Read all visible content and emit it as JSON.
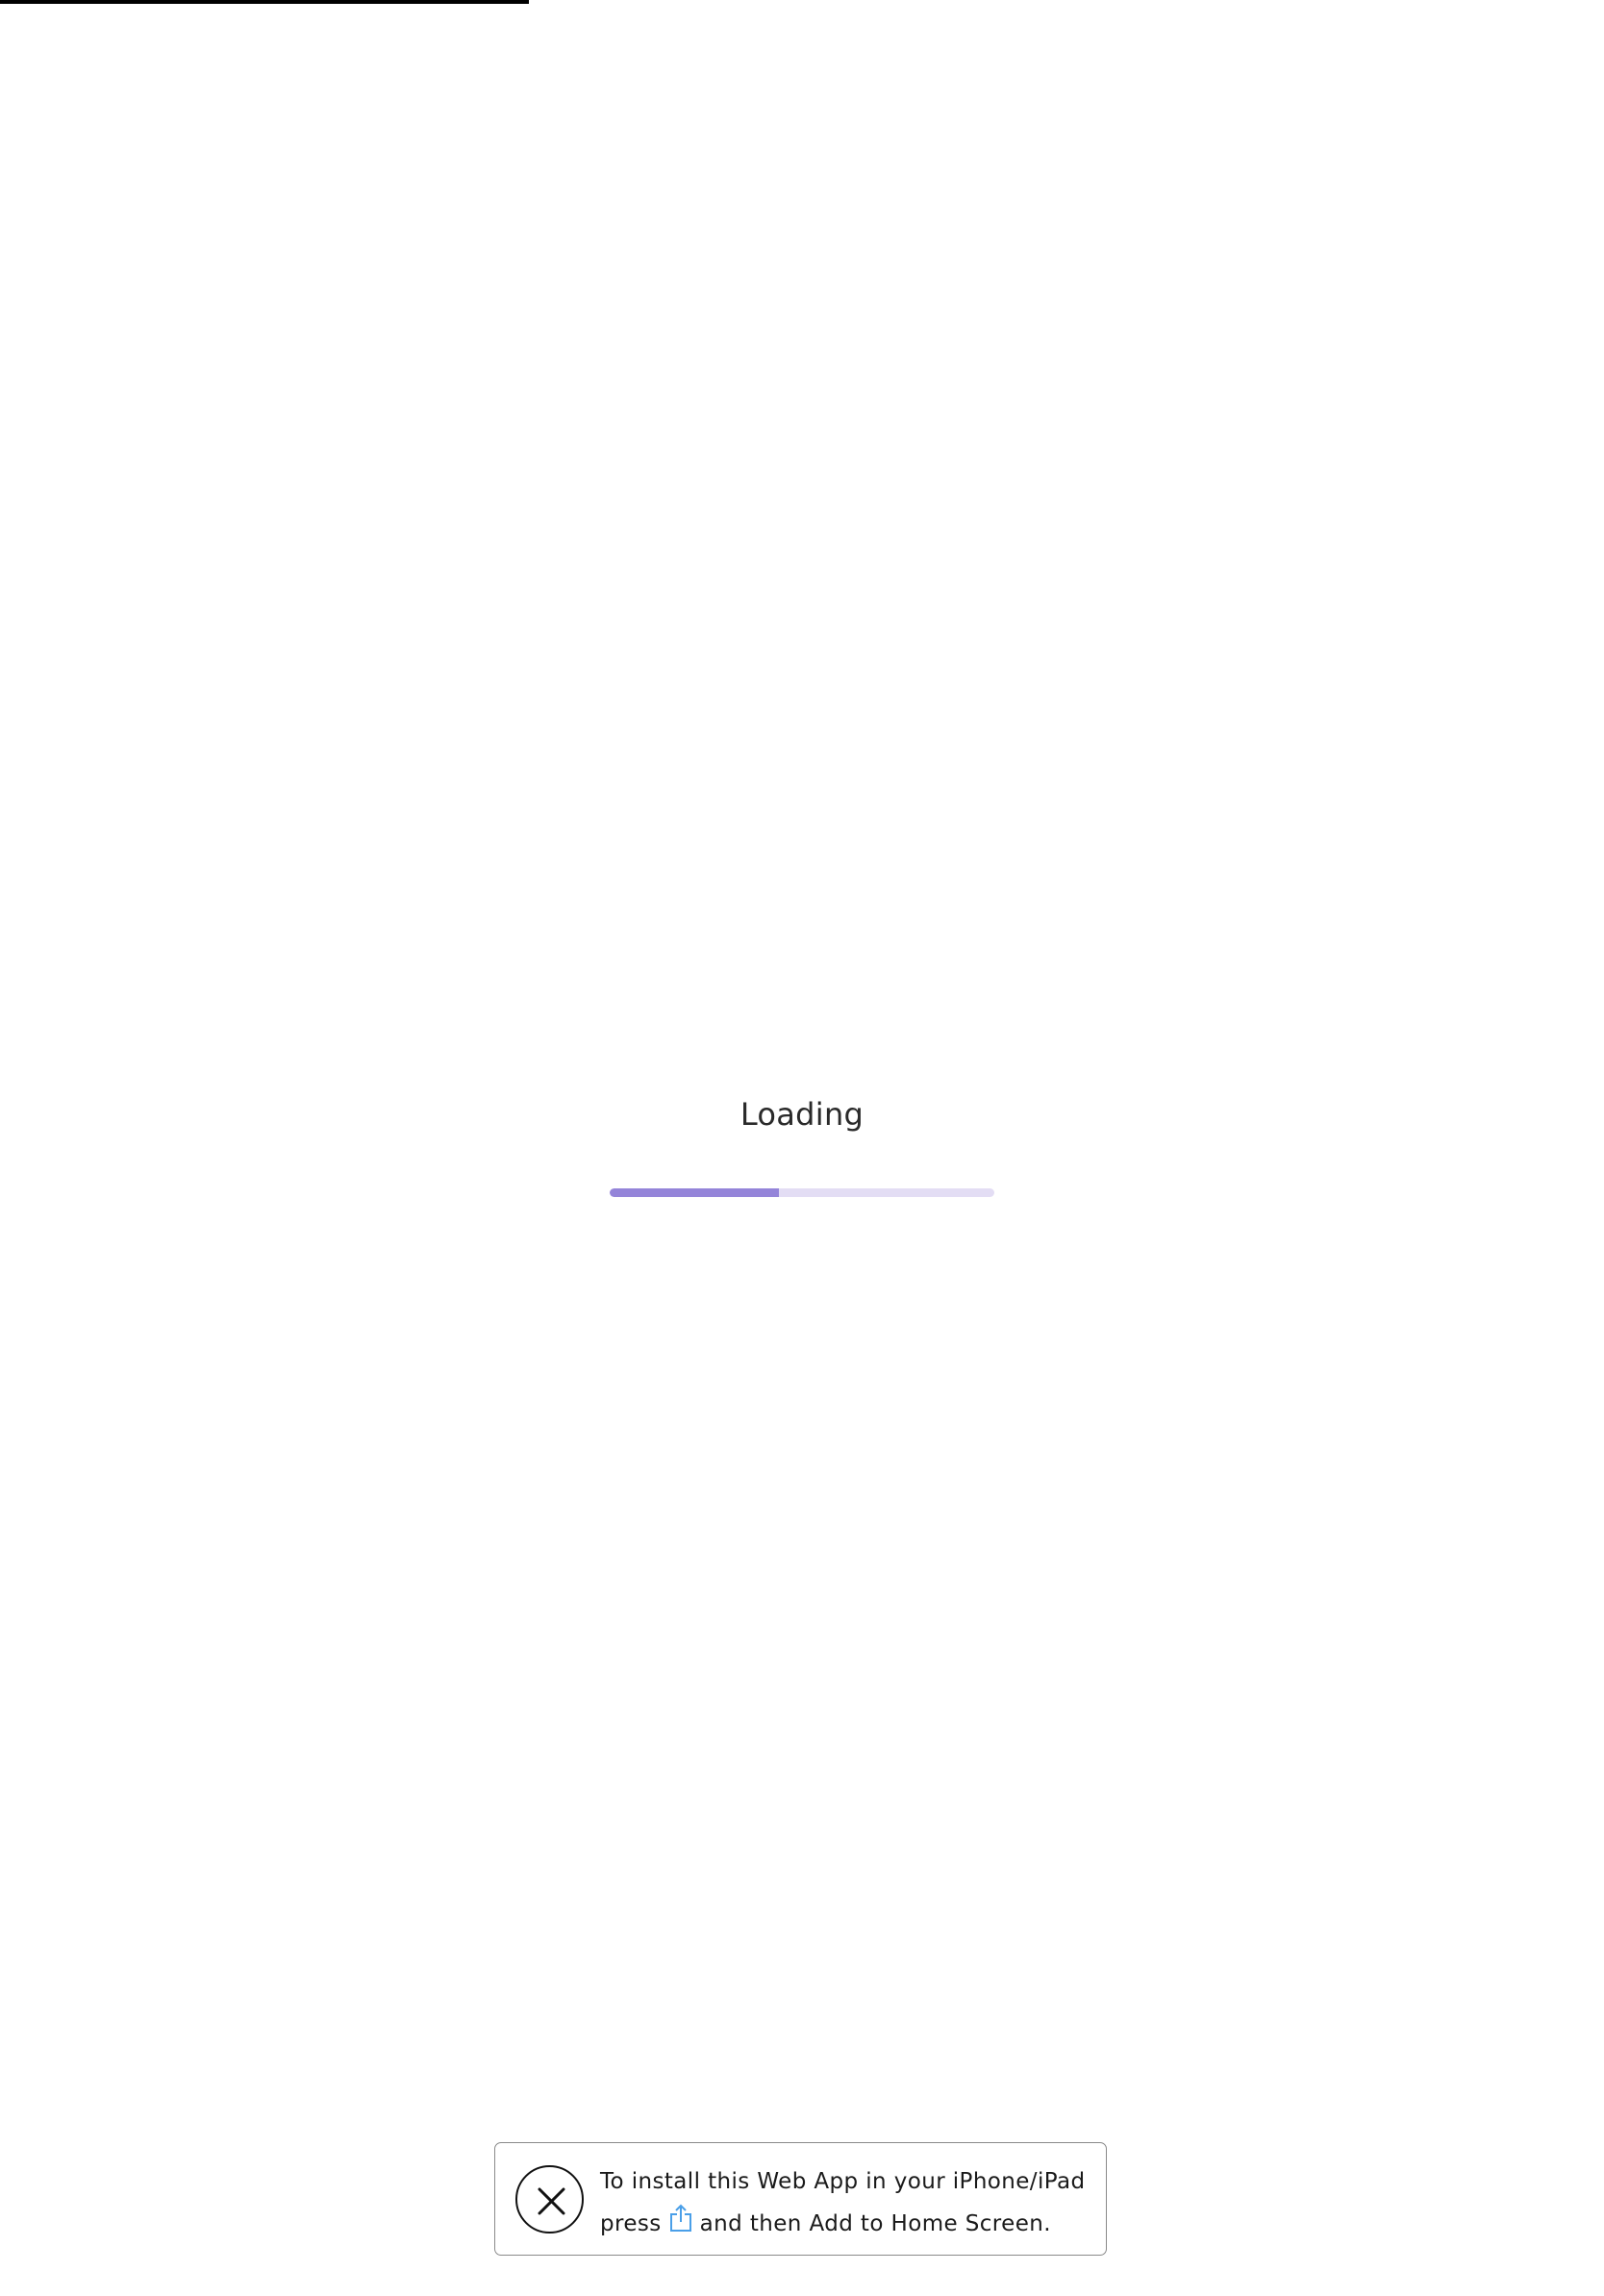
{
  "loading": {
    "label": "Loading",
    "progress_percent": 44
  },
  "install_banner": {
    "line1": "To install this Web App in your iPhone/iPad",
    "press_text": "press",
    "after_icon_text": "and then Add to Home Screen.",
    "close_icon": "close-icon",
    "share_icon": "share-icon"
  },
  "colors": {
    "progress_fill": "#9484d9",
    "progress_track": "#e3ddf4",
    "share_icon": "#4a9fe8"
  }
}
